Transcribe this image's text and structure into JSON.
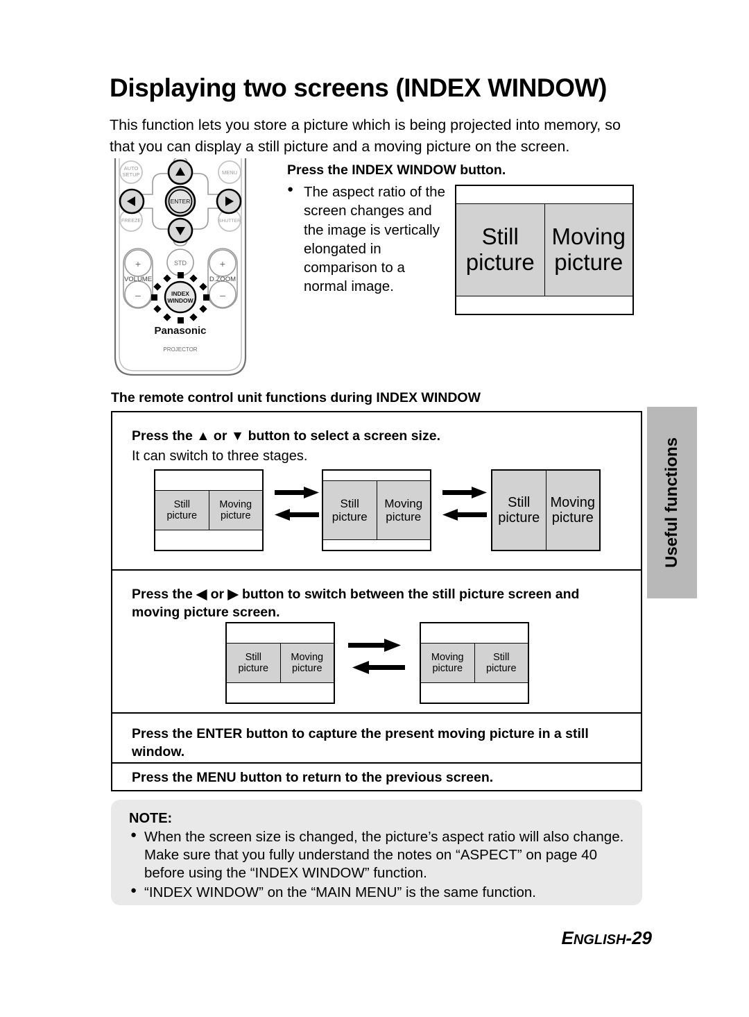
{
  "page": {
    "title": "Displaying two screens (INDEX WINDOW)",
    "intro": "This function lets you store a picture which is being projected into memory, so that you can display a still picture and a moving picture on the screen.",
    "footer_prefix": "E",
    "footer_main": "NGLISH",
    "footer_suffix": "-29"
  },
  "side_tab": {
    "label": "Useful functions"
  },
  "remote": {
    "caption_brand": "Panasonic",
    "caption_type": "PROJECTOR",
    "buttons": {
      "auto_setup": "AUTO\nSETUP",
      "auto_setup_line1": "AUTO",
      "auto_setup_line2": "SETUP",
      "menu": "MENU",
      "freeze": "FREEZE",
      "shutter": "SHUTTER",
      "enter": "ENTER",
      "std": "STD",
      "volume": "VOLUME",
      "dzoom": "D.ZOOM",
      "plus": "+",
      "minus": "–",
      "index_window_line1": "INDEX",
      "index_window_line2": "WINDOW",
      "up_arrow": "▲",
      "down_arrow": "▼",
      "left_arrow": "◀",
      "right_arrow": "▶"
    }
  },
  "step1": {
    "heading": "Press the INDEX WINDOW button.",
    "bullet": "●",
    "body": "The aspect ratio of the screen changes and the image is vertically elongated in comparison to a normal image."
  },
  "hero_diagram": {
    "left_line1": "Still",
    "left_line2": "picture",
    "right_line1": "Moving",
    "right_line2": "picture"
  },
  "section_heading": "The remote control unit functions during INDEX WINDOW",
  "table": {
    "rows": [
      {
        "heading": "Press the ▲ or ▼ button to select a screen size.",
        "sub": "It can switch to three stages.",
        "stages": [
          {
            "left_line1": "Still",
            "left_line2": "picture",
            "right_line1": "Moving",
            "right_line2": "picture"
          },
          {
            "left_line1": "Still",
            "left_line2": "picture",
            "right_line1": "Moving",
            "right_line2": "picture"
          },
          {
            "left_line1": "Still",
            "left_line2": "picture",
            "right_line1": "Moving",
            "right_line2": "picture"
          }
        ]
      },
      {
        "heading": "Press the ◀ or ▶ button to switch between the still picture screen and moving picture screen.",
        "swap": [
          {
            "left_line1": "Still",
            "left_line2": "picture",
            "right_line1": "Moving",
            "right_line2": "picture"
          },
          {
            "left_line1": "Moving",
            "left_line2": "picture",
            "right_line1": "Still",
            "right_line2": "picture"
          }
        ]
      },
      {
        "heading": "Press the ENTER button to capture the present moving picture in a still window."
      },
      {
        "heading": "Press the MENU button to return to the previous screen."
      }
    ]
  },
  "note": {
    "title": "NOTE:",
    "bullet": "●",
    "items": [
      "When the screen size is changed, the picture’s aspect ratio will also change. Make sure that you fully understand the notes on “ASPECT” on page 40 before using the “INDEX WINDOW” function.",
      "“INDEX WINDOW” on the “MAIN MENU” is the same function."
    ]
  },
  "colors": {
    "screen_gray": "#d2d2d2",
    "tab_gray": "#b8b8b8",
    "note_gray": "#e9e9e9",
    "ink": "#000000"
  }
}
